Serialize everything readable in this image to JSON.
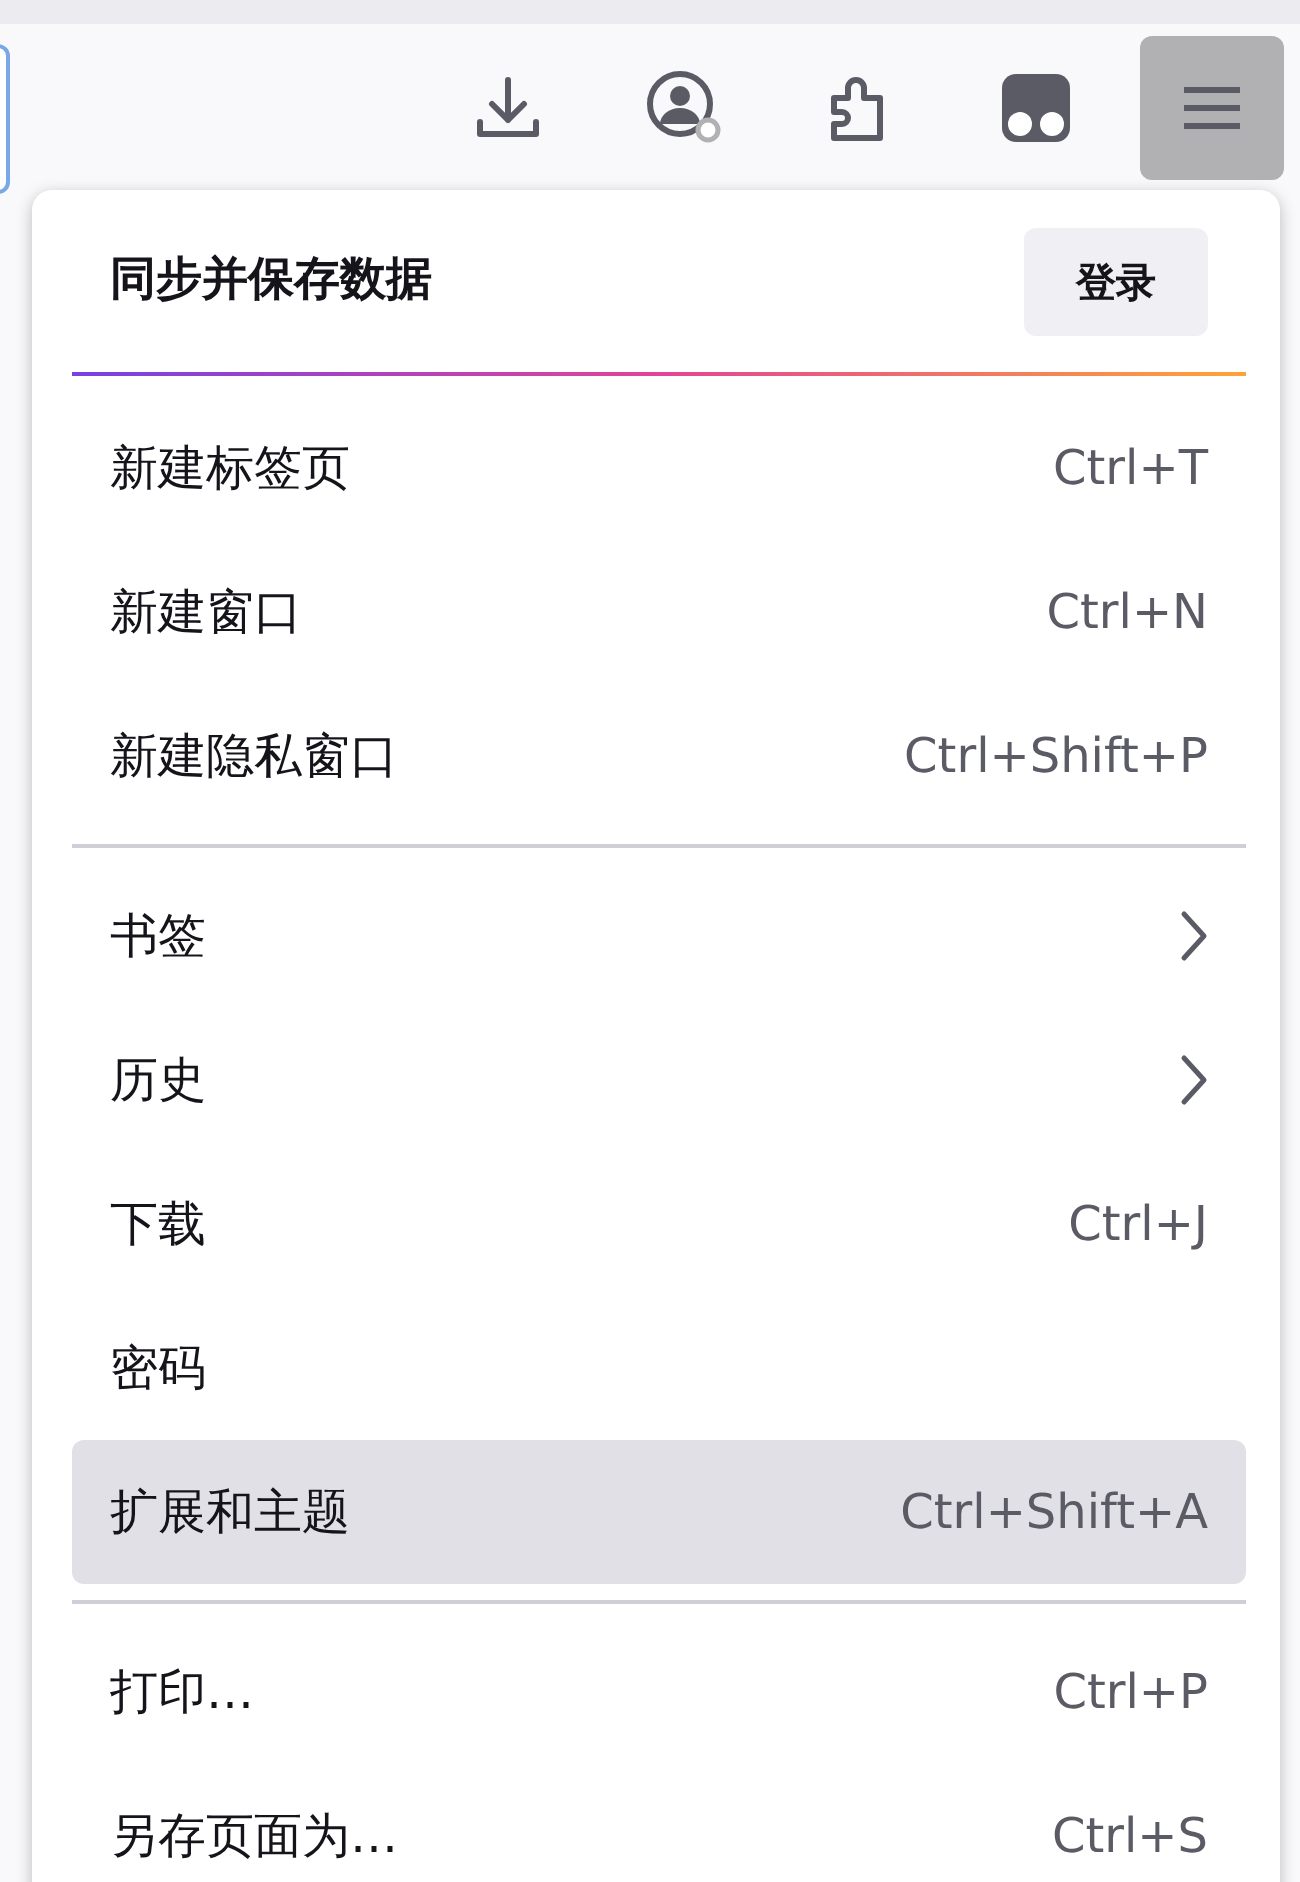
{
  "toolbar": {
    "buttons": [
      {
        "kind": "download"
      },
      {
        "kind": "account"
      },
      {
        "kind": "extensions"
      },
      {
        "kind": "addon"
      },
      {
        "kind": "menu",
        "selected": true
      }
    ]
  },
  "menu": {
    "header": {
      "title": "同步并保存数据",
      "button": "登录"
    },
    "groups": [
      [
        {
          "kind": "shortcut",
          "label": "新建标签页",
          "shortcut": "Ctrl+T",
          "selected": false
        },
        {
          "kind": "shortcut",
          "label": "新建窗口",
          "shortcut": "Ctrl+N",
          "selected": false
        },
        {
          "kind": "shortcut",
          "label": "新建隐私窗口",
          "shortcut": "Ctrl+Shift+P",
          "selected": false
        }
      ],
      [
        {
          "kind": "submenu",
          "label": "书签",
          "selected": false
        },
        {
          "kind": "submenu",
          "label": "历史",
          "selected": false
        },
        {
          "kind": "shortcut",
          "label": "下载",
          "shortcut": "Ctrl+J",
          "selected": false
        },
        {
          "kind": "plain",
          "label": "密码",
          "selected": false
        },
        {
          "kind": "shortcut",
          "label": "扩展和主题",
          "shortcut": "Ctrl+Shift+A",
          "selected": true
        }
      ],
      [
        {
          "kind": "shortcut",
          "label": "打印…",
          "shortcut": "Ctrl+P",
          "selected": false
        },
        {
          "kind": "shortcut",
          "label": "另存页面为…",
          "shortcut": "Ctrl+S",
          "selected": false
        }
      ]
    ]
  }
}
